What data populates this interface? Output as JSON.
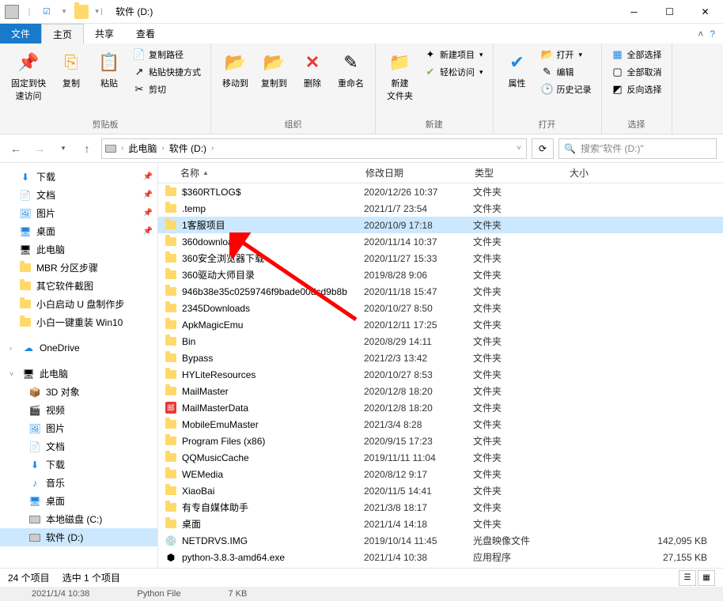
{
  "title": "软件 (D:)",
  "tabs": {
    "file": "文件",
    "home": "主页",
    "share": "共享",
    "view": "查看"
  },
  "ribbon": {
    "clipboard": {
      "label": "剪贴板",
      "pin": "固定到快\n速访问",
      "copy": "复制",
      "paste": "粘贴",
      "copypath": "复制路径",
      "pasteshort": "粘贴快捷方式",
      "cut": "剪切"
    },
    "organize": {
      "label": "组织",
      "moveto": "移动到",
      "copyto": "复制到",
      "delete": "删除",
      "rename": "重命名"
    },
    "new": {
      "label": "新建",
      "newfolder": "新建\n文件夹",
      "newitem": "新建项目",
      "easyaccess": "轻松访问"
    },
    "open": {
      "label": "打开",
      "properties": "属性",
      "open": "打开",
      "edit": "编辑",
      "history": "历史记录"
    },
    "select": {
      "label": "选择",
      "selectall": "全部选择",
      "selectnone": "全部取消",
      "invert": "反向选择"
    }
  },
  "breadcrumb": {
    "thispc": "此电脑",
    "drive": "软件 (D:)"
  },
  "search_placeholder": "搜索\"软件 (D:)\"",
  "columns": {
    "name": "名称",
    "modified": "修改日期",
    "type": "类型",
    "size": "大小"
  },
  "nav": {
    "downloads": "下载",
    "documents": "文档",
    "pictures": "图片",
    "desktop": "桌面",
    "thispc_top": "此电脑",
    "mbr": "MBR 分区步骤",
    "other_soft": "其它软件截图",
    "xiaobai_u": "小白启动 U 盘制作步",
    "xiaobai_win": "小白一键重装 Win10",
    "onedrive": "OneDrive",
    "thispc": "此电脑",
    "3d": "3D 对象",
    "video": "视频",
    "pictures2": "图片",
    "documents2": "文档",
    "downloads2": "下载",
    "music": "音乐",
    "desktop2": "桌面",
    "cdrive": "本地磁盘 (C:)",
    "ddrive": "软件 (D:)"
  },
  "files": [
    {
      "name": "$360RTLOG$",
      "date": "2020/12/26 10:37",
      "type": "文件夹",
      "size": "",
      "icon": "folder"
    },
    {
      "name": ".temp",
      "date": "2021/1/7 23:54",
      "type": "文件夹",
      "size": "",
      "icon": "folder"
    },
    {
      "name": "1客服项目",
      "date": "2020/10/9 17:18",
      "type": "文件夹",
      "size": "",
      "icon": "folder",
      "sel": true
    },
    {
      "name": "360downloads",
      "date": "2020/11/14 10:37",
      "type": "文件夹",
      "size": "",
      "icon": "folder"
    },
    {
      "name": "360安全浏览器下载",
      "date": "2020/11/27 15:33",
      "type": "文件夹",
      "size": "",
      "icon": "folder"
    },
    {
      "name": "360驱动大师目录",
      "date": "2019/8/28 9:06",
      "type": "文件夹",
      "size": "",
      "icon": "folder"
    },
    {
      "name": "946b38e35c0259746f9bade00dcd9b8b",
      "date": "2020/11/18 15:47",
      "type": "文件夹",
      "size": "",
      "icon": "folder"
    },
    {
      "name": "2345Downloads",
      "date": "2020/10/27 8:50",
      "type": "文件夹",
      "size": "",
      "icon": "folder"
    },
    {
      "name": "ApkMagicEmu",
      "date": "2020/12/11 17:25",
      "type": "文件夹",
      "size": "",
      "icon": "folder"
    },
    {
      "name": "Bin",
      "date": "2020/8/29 14:11",
      "type": "文件夹",
      "size": "",
      "icon": "folder"
    },
    {
      "name": "Bypass",
      "date": "2021/2/3 13:42",
      "type": "文件夹",
      "size": "",
      "icon": "folder"
    },
    {
      "name": "HYLiteResources",
      "date": "2020/10/27 8:53",
      "type": "文件夹",
      "size": "",
      "icon": "folder"
    },
    {
      "name": "MailMaster",
      "date": "2020/12/8 18:20",
      "type": "文件夹",
      "size": "",
      "icon": "folder"
    },
    {
      "name": "MailMasterData",
      "date": "2020/12/8 18:20",
      "type": "文件夹",
      "size": "",
      "icon": "mail"
    },
    {
      "name": "MobileEmuMaster",
      "date": "2021/3/4 8:28",
      "type": "文件夹",
      "size": "",
      "icon": "folder"
    },
    {
      "name": "Program Files (x86)",
      "date": "2020/9/15 17:23",
      "type": "文件夹",
      "size": "",
      "icon": "folder"
    },
    {
      "name": "QQMusicCache",
      "date": "2019/11/11 11:04",
      "type": "文件夹",
      "size": "",
      "icon": "folder"
    },
    {
      "name": "WEMedia",
      "date": "2020/8/12 9:17",
      "type": "文件夹",
      "size": "",
      "icon": "folder"
    },
    {
      "name": "XiaoBai",
      "date": "2020/11/5 14:41",
      "type": "文件夹",
      "size": "",
      "icon": "folder"
    },
    {
      "name": "有专自媒体助手",
      "date": "2021/3/8 18:17",
      "type": "文件夹",
      "size": "",
      "icon": "folder"
    },
    {
      "name": "桌面",
      "date": "2021/1/4 14:18",
      "type": "文件夹",
      "size": "",
      "icon": "folder"
    },
    {
      "name": "NETDRVS.IMG",
      "date": "2019/10/14 11:45",
      "type": "光盘映像文件",
      "size": "142,095 KB",
      "icon": "disc"
    },
    {
      "name": "python-3.8.3-amd64.exe",
      "date": "2021/1/4 10:38",
      "type": "应用程序",
      "size": "27,155 KB",
      "icon": "exe"
    }
  ],
  "status": {
    "items": "24 个项目",
    "selected": "选中 1 个项目"
  },
  "leak": {
    "date": "2021/1/4 10:38",
    "type": "Python File",
    "size": "7 KB"
  }
}
